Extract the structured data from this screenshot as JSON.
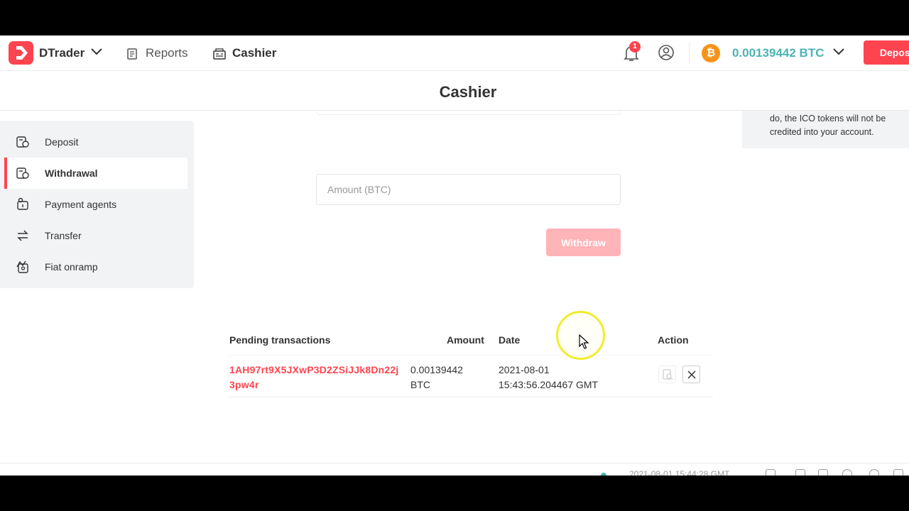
{
  "header": {
    "brand": "DTrader",
    "nav": {
      "reports": "Reports",
      "cashier": "Cashier"
    },
    "notification_count": "1",
    "btc_symbol": "₿",
    "balance": "0.00139442 BTC",
    "deposit_label": "Deposit"
  },
  "page": {
    "title": "Cashier"
  },
  "sidebar": {
    "items": [
      {
        "label": "Deposit",
        "icon": "wallet-deposit-icon"
      },
      {
        "label": "Withdrawal",
        "icon": "wallet-withdraw-icon",
        "active": true
      },
      {
        "label": "Payment agents",
        "icon": "payment-agent-icon"
      },
      {
        "label": "Transfer",
        "icon": "transfer-icon"
      },
      {
        "label": "Fiat onramp",
        "icon": "fiat-onramp-icon"
      }
    ]
  },
  "form": {
    "amount_placeholder": "Amount (BTC)",
    "withdraw_label": "Withdraw"
  },
  "info": {
    "text": "do, the ICO tokens will not be credited into your account."
  },
  "transactions": {
    "headers": {
      "pending": "Pending transactions",
      "amount": "Amount",
      "date": "Date",
      "action": "Action"
    },
    "rows": [
      {
        "address": "1AH97rt9X5JXwP3D2ZSiJJk8Dn22j3pw4r",
        "amount": "0.00139442 BTC",
        "date": "2021-08-01 15:43:56.204467 GMT"
      }
    ]
  },
  "footer": {
    "time": "2021-08-01 15:44:28 GMT"
  },
  "colors": {
    "brand": "#ff444f",
    "balance": "#4bb4b3",
    "btc": "#f7931a"
  }
}
